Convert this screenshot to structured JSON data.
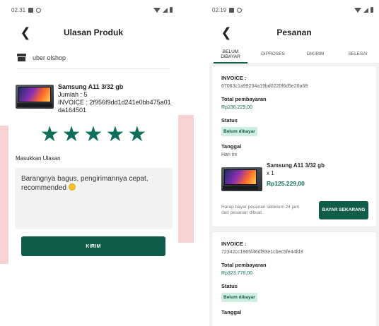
{
  "left": {
    "status_bar": {
      "time": "02.31"
    },
    "title": "Ulasan Produk",
    "shop_name": "uber olshop",
    "product": {
      "name": "Samsung A11 3/32 gb",
      "quantity": "Jumlah : 5",
      "invoice": "INVOICE : 2f956f9dd1d241e0bb475a01da164501"
    },
    "rating": 5,
    "review_label": "Masukkan Ulasan",
    "review_text": "Barangnya bagus, pengirimannya cepat, recommended",
    "submit_label": "KIRIM"
  },
  "right": {
    "status_bar": {
      "time": "02.19"
    },
    "title": "Pesanan",
    "tabs": [
      {
        "label": "BELUM DIBAYAR",
        "active": true
      },
      {
        "label": "DIPROSES",
        "active": false
      },
      {
        "label": "DIKIRIM",
        "active": false
      },
      {
        "label": "SELESAI",
        "active": false
      }
    ],
    "orders": [
      {
        "invoice_label": "INVOICE :",
        "invoice": "67063c1a99234a19bd0220f6d5e20a68",
        "total_label": "Total pembayaran",
        "total": "Rp236.229,00",
        "status_label": "Status",
        "status": "Belum dibayar",
        "date_label": "Tanggal",
        "date": "Hari ini",
        "item_name": "Samsung A11 3/32 gb",
        "item_qty": "x 1",
        "item_price": "Rp125.229,00",
        "note": "Harap bayar pesanan sebelum 24 jam dari pesanan dibuat.",
        "pay_label": "BAYAR SEKARANG"
      },
      {
        "invoice_label": "INVOICE :",
        "invoice": "72342cc1965f46df93e1cbec5fe44fd3",
        "total_label": "Total pembayaran",
        "total": "Rp323.778,00",
        "status_label": "Status",
        "status": "Belum dibayar",
        "date_label": "Tanggal"
      }
    ]
  },
  "colors": {
    "accent": "#0f5c49",
    "star": "#0f6e5a",
    "badge_bg": "#cfeee0",
    "deco": "#f6d2d2"
  }
}
